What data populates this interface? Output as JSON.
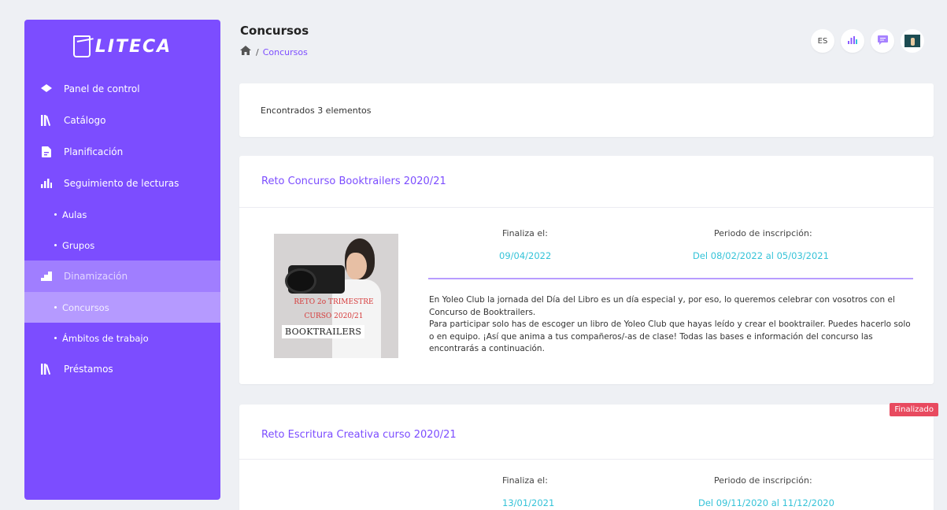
{
  "app": {
    "logo_text": "LITECA"
  },
  "sidebar": {
    "items": [
      {
        "label": "Panel de control"
      },
      {
        "label": "Catálogo"
      },
      {
        "label": "Planificación"
      },
      {
        "label": "Seguimiento de lecturas"
      },
      {
        "label": "Aulas"
      },
      {
        "label": "Grupos"
      },
      {
        "label": "Dinamización"
      },
      {
        "label": "Concursos"
      },
      {
        "label": "Ámbitos de trabajo"
      },
      {
        "label": "Préstamos"
      }
    ]
  },
  "header": {
    "title": "Concursos",
    "breadcrumb": {
      "separator": "/",
      "current": "Concursos"
    },
    "lang": "ES"
  },
  "results": {
    "count_text": "Encontrados 3 elementos"
  },
  "contests": [
    {
      "title": "Reto Concurso Booktrailers 2020/21",
      "ends_label": "Finaliza el:",
      "ends_value": "09/04/2022",
      "period_label": "Periodo de inscripción:",
      "period_value": "Del 08/02/2022 al 05/03/2021",
      "image_lines": [
        "RETO 2o TRIMESTRE",
        "CURSO 2020/21",
        "BOOKTRAILERS"
      ],
      "description": [
        "En Yoleo Club la jornada del Día del Libro es un día especial y, por eso, lo queremos celebrar con vosotros con el Concurso de Booktrailers.",
        "Para participar solo has de escoger un libro de Yoleo Club que hayas leído y crear el booktrailer. Puedes hacerlo solo o en equipo. ¡Así que anima a tus compañeros/-as de clase! Todas las bases e información del concurso las encontrarás a continuación."
      ]
    },
    {
      "title": "Reto Escritura Creativa curso 2020/21",
      "badge": "Finalizado",
      "ends_label": "Finaliza el:",
      "ends_value": "13/01/2021",
      "period_label": "Periodo de inscripción:",
      "period_value": "Del 09/11/2020 al 11/12/2020"
    }
  ],
  "colors": {
    "accent": "#7c4dff",
    "value": "#35c3d8",
    "badge": "#e84a5f"
  }
}
